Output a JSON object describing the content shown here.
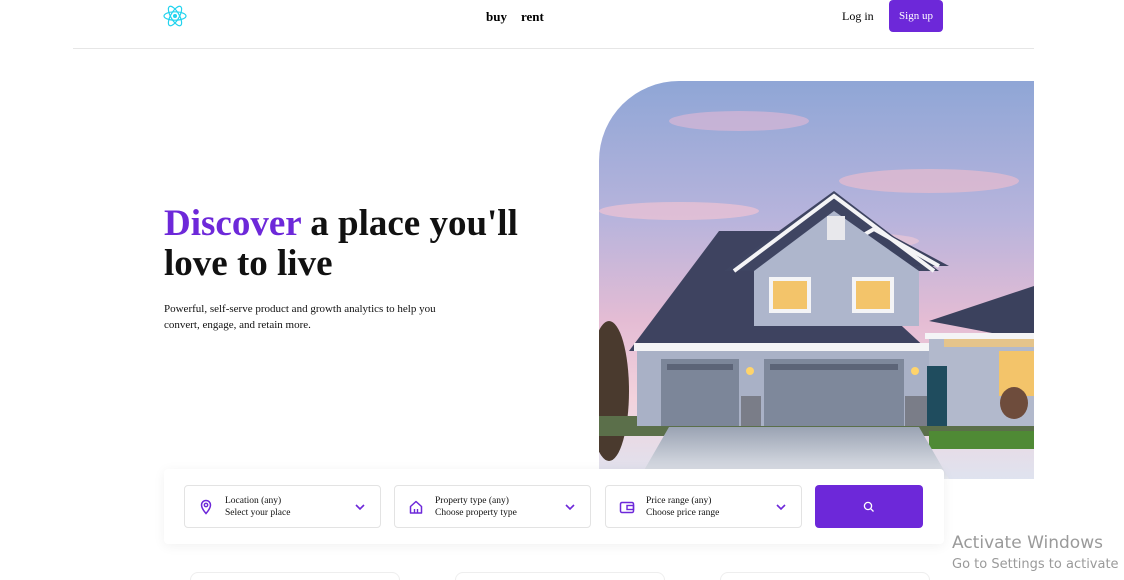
{
  "header": {
    "nav": [
      {
        "label": "buy"
      },
      {
        "label": "rent"
      }
    ],
    "login_label": "Log in",
    "signup_label": "Sign up"
  },
  "hero": {
    "title_accent": "Discover",
    "title_rest": " a place you'll love to live",
    "description": "Powerful, self-serve product and growth analytics to help you convert, engage, and retain more."
  },
  "search": {
    "fields": [
      {
        "label": "Location (any)",
        "value": "Select your place",
        "icon": "location-pin-icon"
      },
      {
        "label": "Property type (any)",
        "value": "Choose property type",
        "icon": "house-icon"
      },
      {
        "label": "Price range (any)",
        "value": "Choose price range",
        "icon": "wallet-icon"
      }
    ],
    "button_icon": "search-icon"
  },
  "overlay": {
    "title": "Activate Windows",
    "subtitle": "Go to Settings to activate"
  },
  "colors": {
    "accent": "#6d28d9",
    "logo": "#22d3ee"
  }
}
